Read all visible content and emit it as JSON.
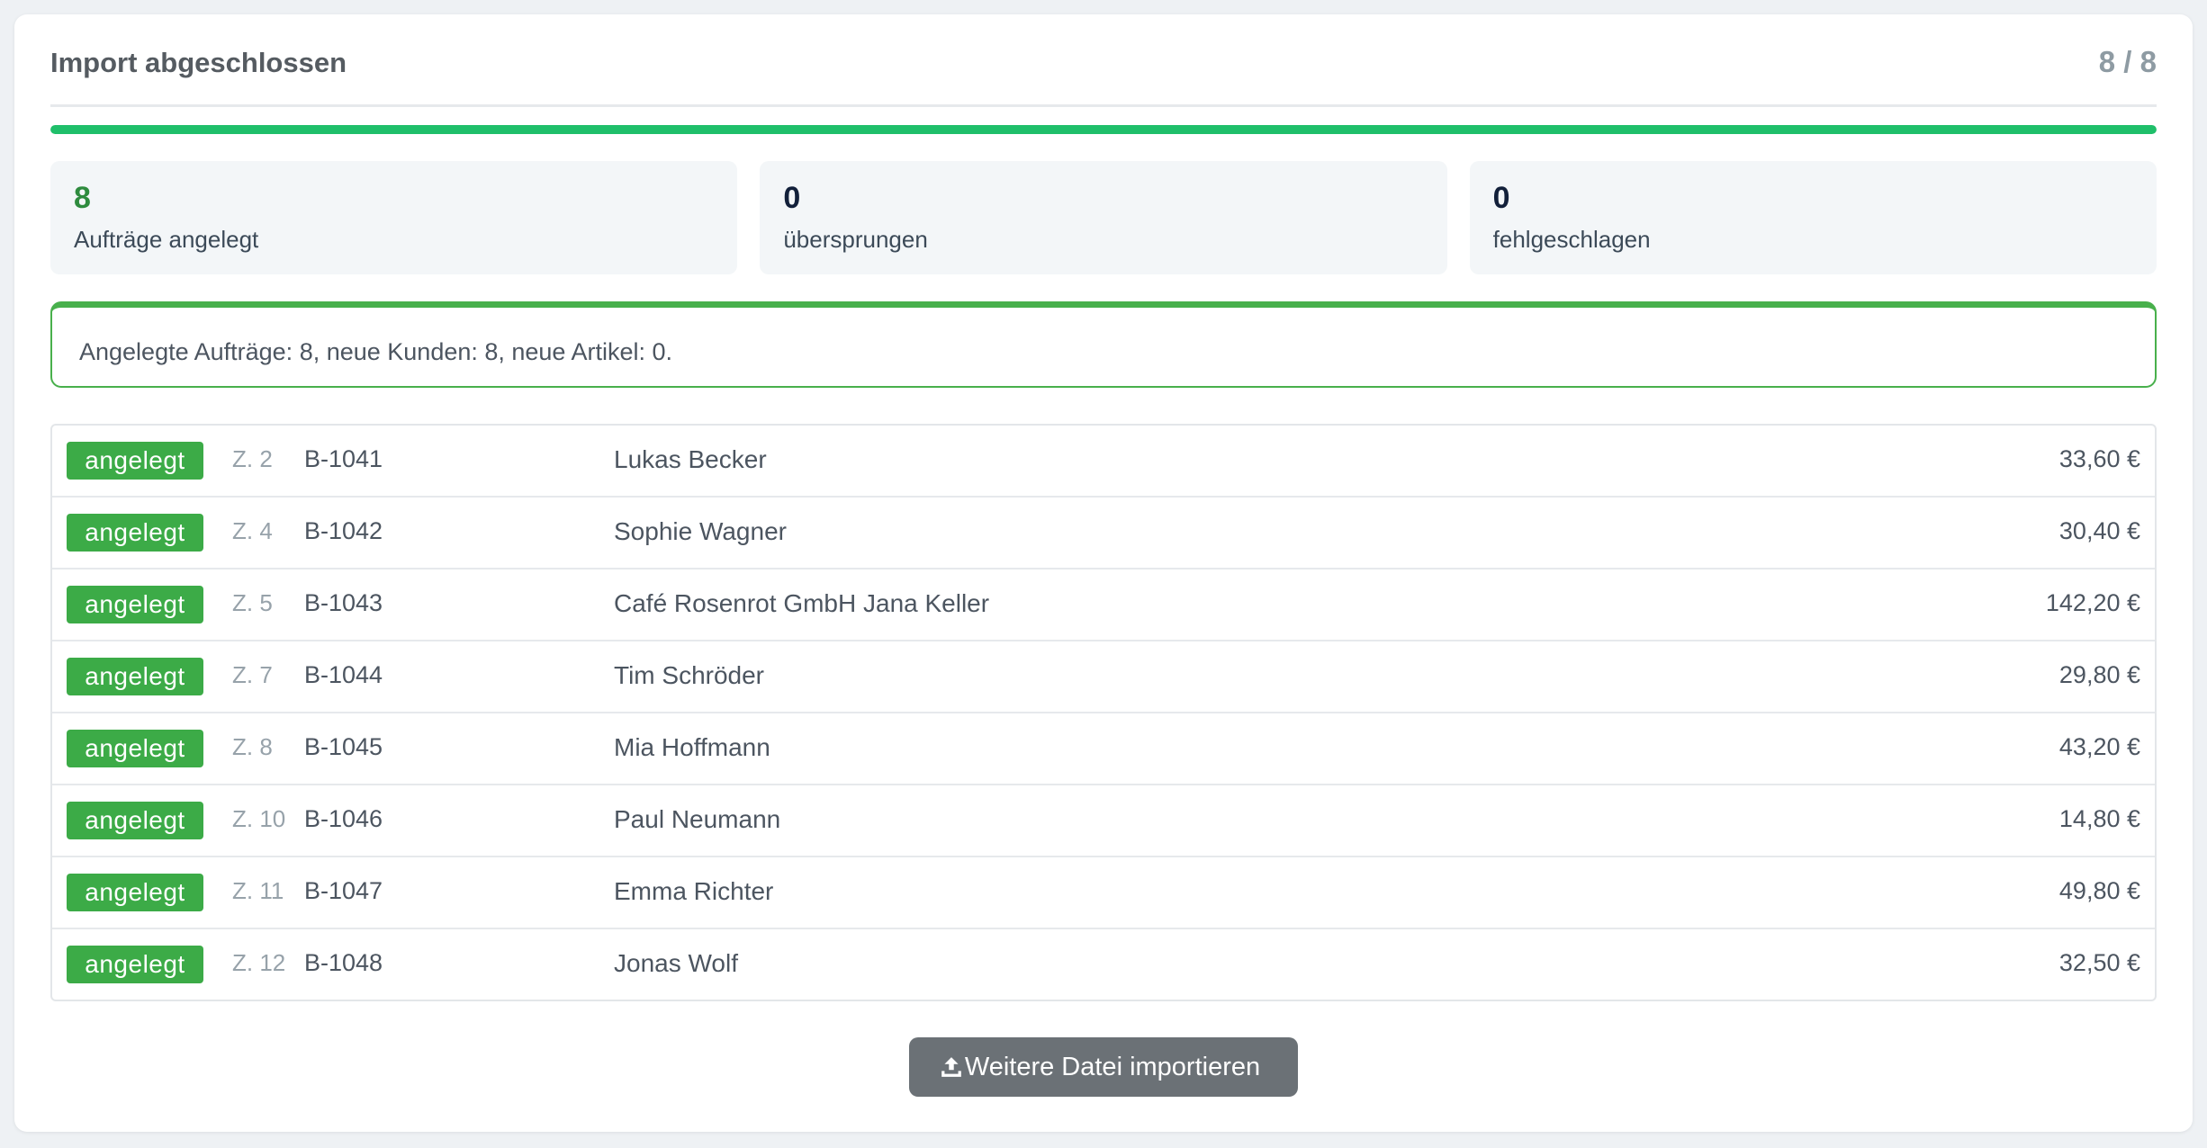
{
  "header": {
    "title": "Import abgeschlossen",
    "count": "8 / 8"
  },
  "progress": {
    "value": 1.0,
    "color": "#1fbf6a"
  },
  "stats": [
    {
      "value": "8",
      "label": "Aufträge angelegt"
    },
    {
      "value": "0",
      "label": "übersprungen"
    },
    {
      "value": "0",
      "label": "fehlgeschlagen"
    }
  ],
  "alert": {
    "text": "Angelegte Aufträge: 8, neue Kunden: 8, neue Artikel: 0."
  },
  "rows": [
    {
      "status": "angelegt",
      "zeile": "Z. 2",
      "order": "B-1041",
      "name": "Lukas Becker",
      "amount": "33,60 €"
    },
    {
      "status": "angelegt",
      "zeile": "Z. 4",
      "order": "B-1042",
      "name": "Sophie Wagner",
      "amount": "30,40 €"
    },
    {
      "status": "angelegt",
      "zeile": "Z. 5",
      "order": "B-1043",
      "name": "Café Rosenrot GmbH Jana Keller",
      "amount": "142,20 €"
    },
    {
      "status": "angelegt",
      "zeile": "Z. 7",
      "order": "B-1044",
      "name": "Tim Schröder",
      "amount": "29,80 €"
    },
    {
      "status": "angelegt",
      "zeile": "Z. 8",
      "order": "B-1045",
      "name": "Mia Hoffmann",
      "amount": "43,20 €"
    },
    {
      "status": "angelegt",
      "zeile": "Z. 10",
      "order": "B-1046",
      "name": "Paul Neumann",
      "amount": "14,80 €"
    },
    {
      "status": "angelegt",
      "zeile": "Z. 11",
      "order": "B-1047",
      "name": "Emma Richter",
      "amount": "49,80 €"
    },
    {
      "status": "angelegt",
      "zeile": "Z. 12",
      "order": "B-1048",
      "name": "Jonas Wolf",
      "amount": "32,50 €"
    }
  ],
  "button": {
    "label": "Weitere Datei importieren",
    "icon": "upload-icon"
  },
  "colors": {
    "success": "#3cab47",
    "stat_green": "#2e8b3e",
    "button_bg": "#6b7176"
  }
}
